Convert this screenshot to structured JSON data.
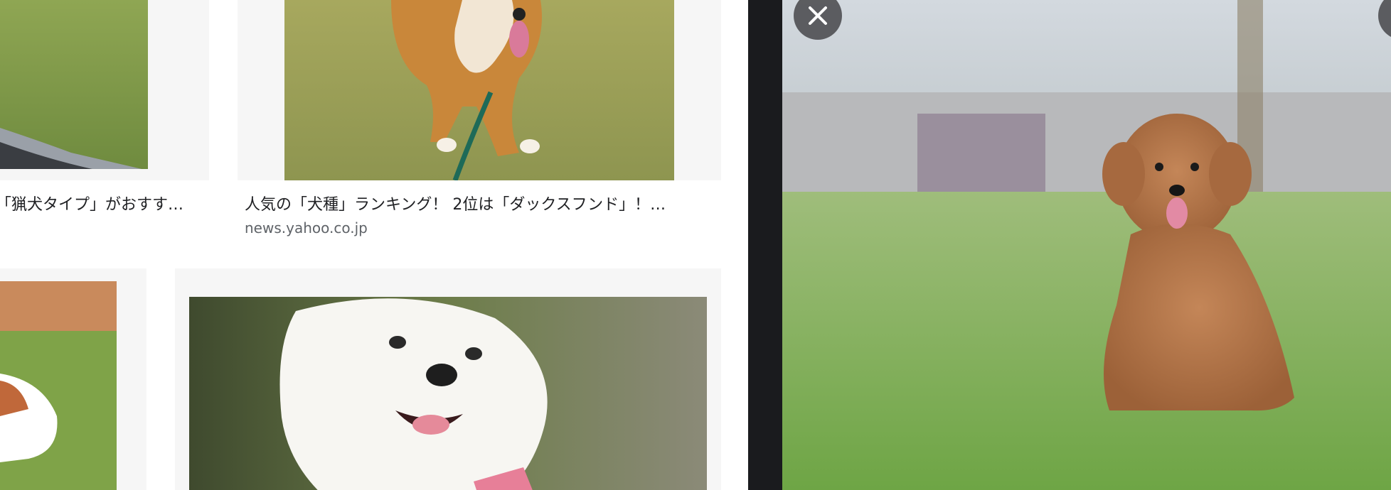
{
  "results": [
    {
      "caption": "「猟犬タイプ」がおすす…",
      "source": ""
    },
    {
      "caption": "人気の「犬種」ランキング！ 2位は「ダックスフンド」！…",
      "source": "news.yahoo.co.jp"
    }
  ],
  "preview": {
    "close_icon": "close-icon",
    "image_subject": "toy-poodle-photo"
  },
  "colors": {
    "tile_bg": "#f6f6f6",
    "divider": "#1a1b1e",
    "text_primary": "#202124",
    "text_secondary": "#5f6368"
  }
}
